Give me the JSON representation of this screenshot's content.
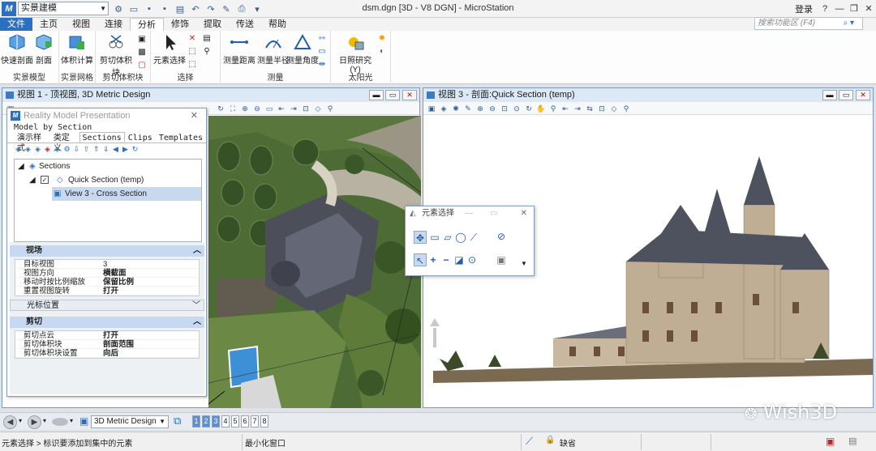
{
  "app": {
    "window_title": "dsm.dgn [3D - V8 DGN] - MicroStation",
    "workspace": "实景建模",
    "login": "登录",
    "search_placeholder": "搜索功能区 (F4)"
  },
  "ribbon_tabs": [
    "文件",
    "主页",
    "视图",
    "连接",
    "分析",
    "修饰",
    "提取",
    "传送",
    "帮助"
  ],
  "ribbon": {
    "groups": [
      {
        "label": "实景模型",
        "buttons": [
          "快速剖面",
          "剖面"
        ]
      },
      {
        "label": "实景网格",
        "buttons": [
          "体积计算"
        ]
      },
      {
        "label": "剪切体积块",
        "buttons": [
          "剪切体积块"
        ]
      },
      {
        "label": "选择",
        "buttons": [
          "元素选择"
        ]
      },
      {
        "label": "测量",
        "buttons": [
          "测量距离",
          "测量半径",
          "测量角度"
        ]
      },
      {
        "label": "太阳光",
        "buttons": [
          "日照研究(Y)"
        ]
      }
    ]
  },
  "view1": {
    "title": "视图 1 - 顶视图, 3D Metric Design"
  },
  "view3": {
    "title": "视图 3 - 剖面:Quick Section (temp)"
  },
  "rmp": {
    "title": "Reality Model Presentation",
    "mode_label": "Model by Section",
    "tabs": [
      "演示样式",
      "类定义",
      "Sections",
      "Clips",
      "Templates"
    ],
    "tree": {
      "root": "Sections",
      "child": "Quick Section (temp)",
      "grandchild": "View 3 - Cross Section"
    },
    "sections": {
      "view": {
        "title": "视场",
        "rows": [
          {
            "k": "目标视图",
            "v": "3"
          },
          {
            "k": "视图方向",
            "v": "横截面"
          },
          {
            "k": "移动时按比例缩放",
            "v": "保留比例"
          },
          {
            "k": "重置视图旋转",
            "v": "打开"
          }
        ]
      },
      "cursor": {
        "title": "光标位置"
      },
      "clip": {
        "title": "剪切",
        "rows": [
          {
            "k": "剪切点云",
            "v": "打开"
          },
          {
            "k": "剪切体积块",
            "v": "剖面范围"
          },
          {
            "k": "剪切体积块设置",
            "v": "向后"
          }
        ]
      }
    }
  },
  "element_selection": {
    "title": "元素选择"
  },
  "bottom": {
    "view_select": "3D Metric Design",
    "view_numbers": [
      "1",
      "2",
      "3",
      "4",
      "5",
      "6",
      "7",
      "8"
    ],
    "active_views": [
      "1",
      "2",
      "3"
    ]
  },
  "status": {
    "message": "元素选择 > 标识要添加到集中的元素",
    "prompt": "最小化窗口",
    "level": "缺省"
  },
  "watermark": "Wish3D",
  "colors": {
    "accent": "#2a6fc0",
    "panel_header": "#c6d9f0"
  }
}
